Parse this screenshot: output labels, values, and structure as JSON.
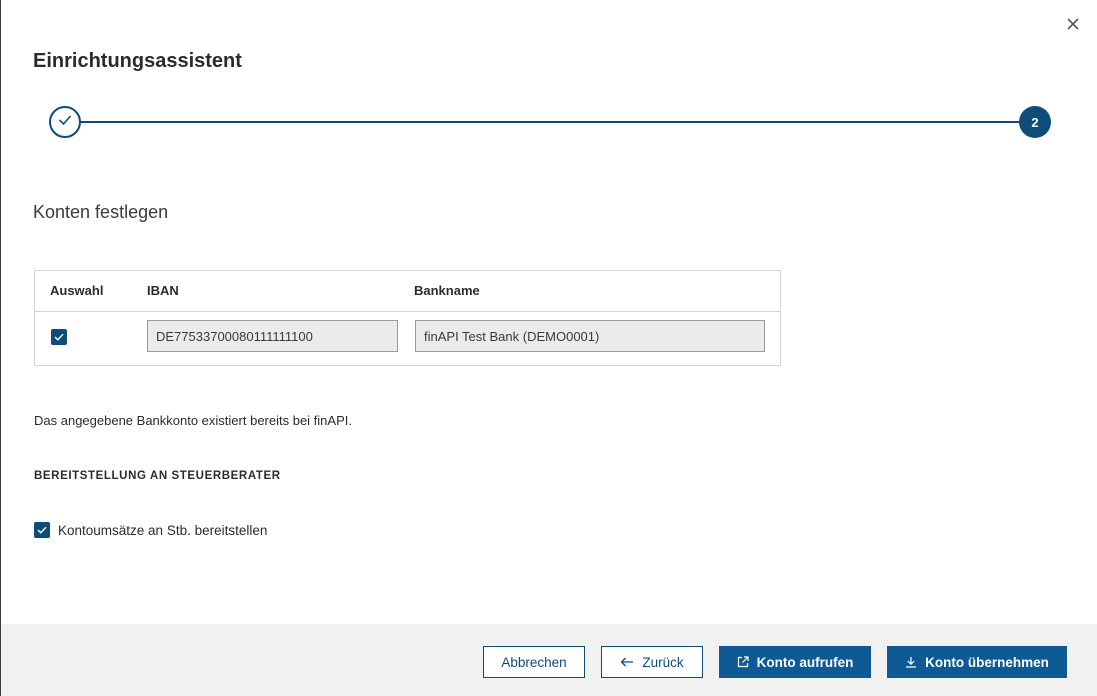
{
  "dialog": {
    "title": "Einrichtungsassistent",
    "close_icon": "close-icon"
  },
  "stepper": {
    "steps": [
      {
        "state": "completed",
        "icon": "check-icon"
      },
      {
        "state": "current",
        "label": "2"
      }
    ]
  },
  "section": {
    "title": "Konten festlegen"
  },
  "table": {
    "columns": [
      "Auswahl",
      "IBAN",
      "Bankname"
    ],
    "rows": [
      {
        "selected": true,
        "iban": "DE77533700080111111100",
        "bankname": "finAPI Test Bank (DEMO0001)"
      }
    ]
  },
  "info_text": "Das angegebene Bankkonto existiert bereits bei finAPI.",
  "provision": {
    "heading": "BEREITSTELLUNG AN STEUERBERATER",
    "option_label": "Kontoumsätze an Stb. bereitstellen",
    "option_checked": true
  },
  "footer": {
    "cancel_label": "Abbrechen",
    "back_label": "Zurück",
    "open_account_label": "Konto aufrufen",
    "accept_account_label": "Konto übernehmen"
  },
  "colors": {
    "primary": "#0e5a94",
    "accent_dark": "#0e4d7a",
    "footer_bg": "#f1f1f1",
    "field_bg": "#ebebeb"
  }
}
